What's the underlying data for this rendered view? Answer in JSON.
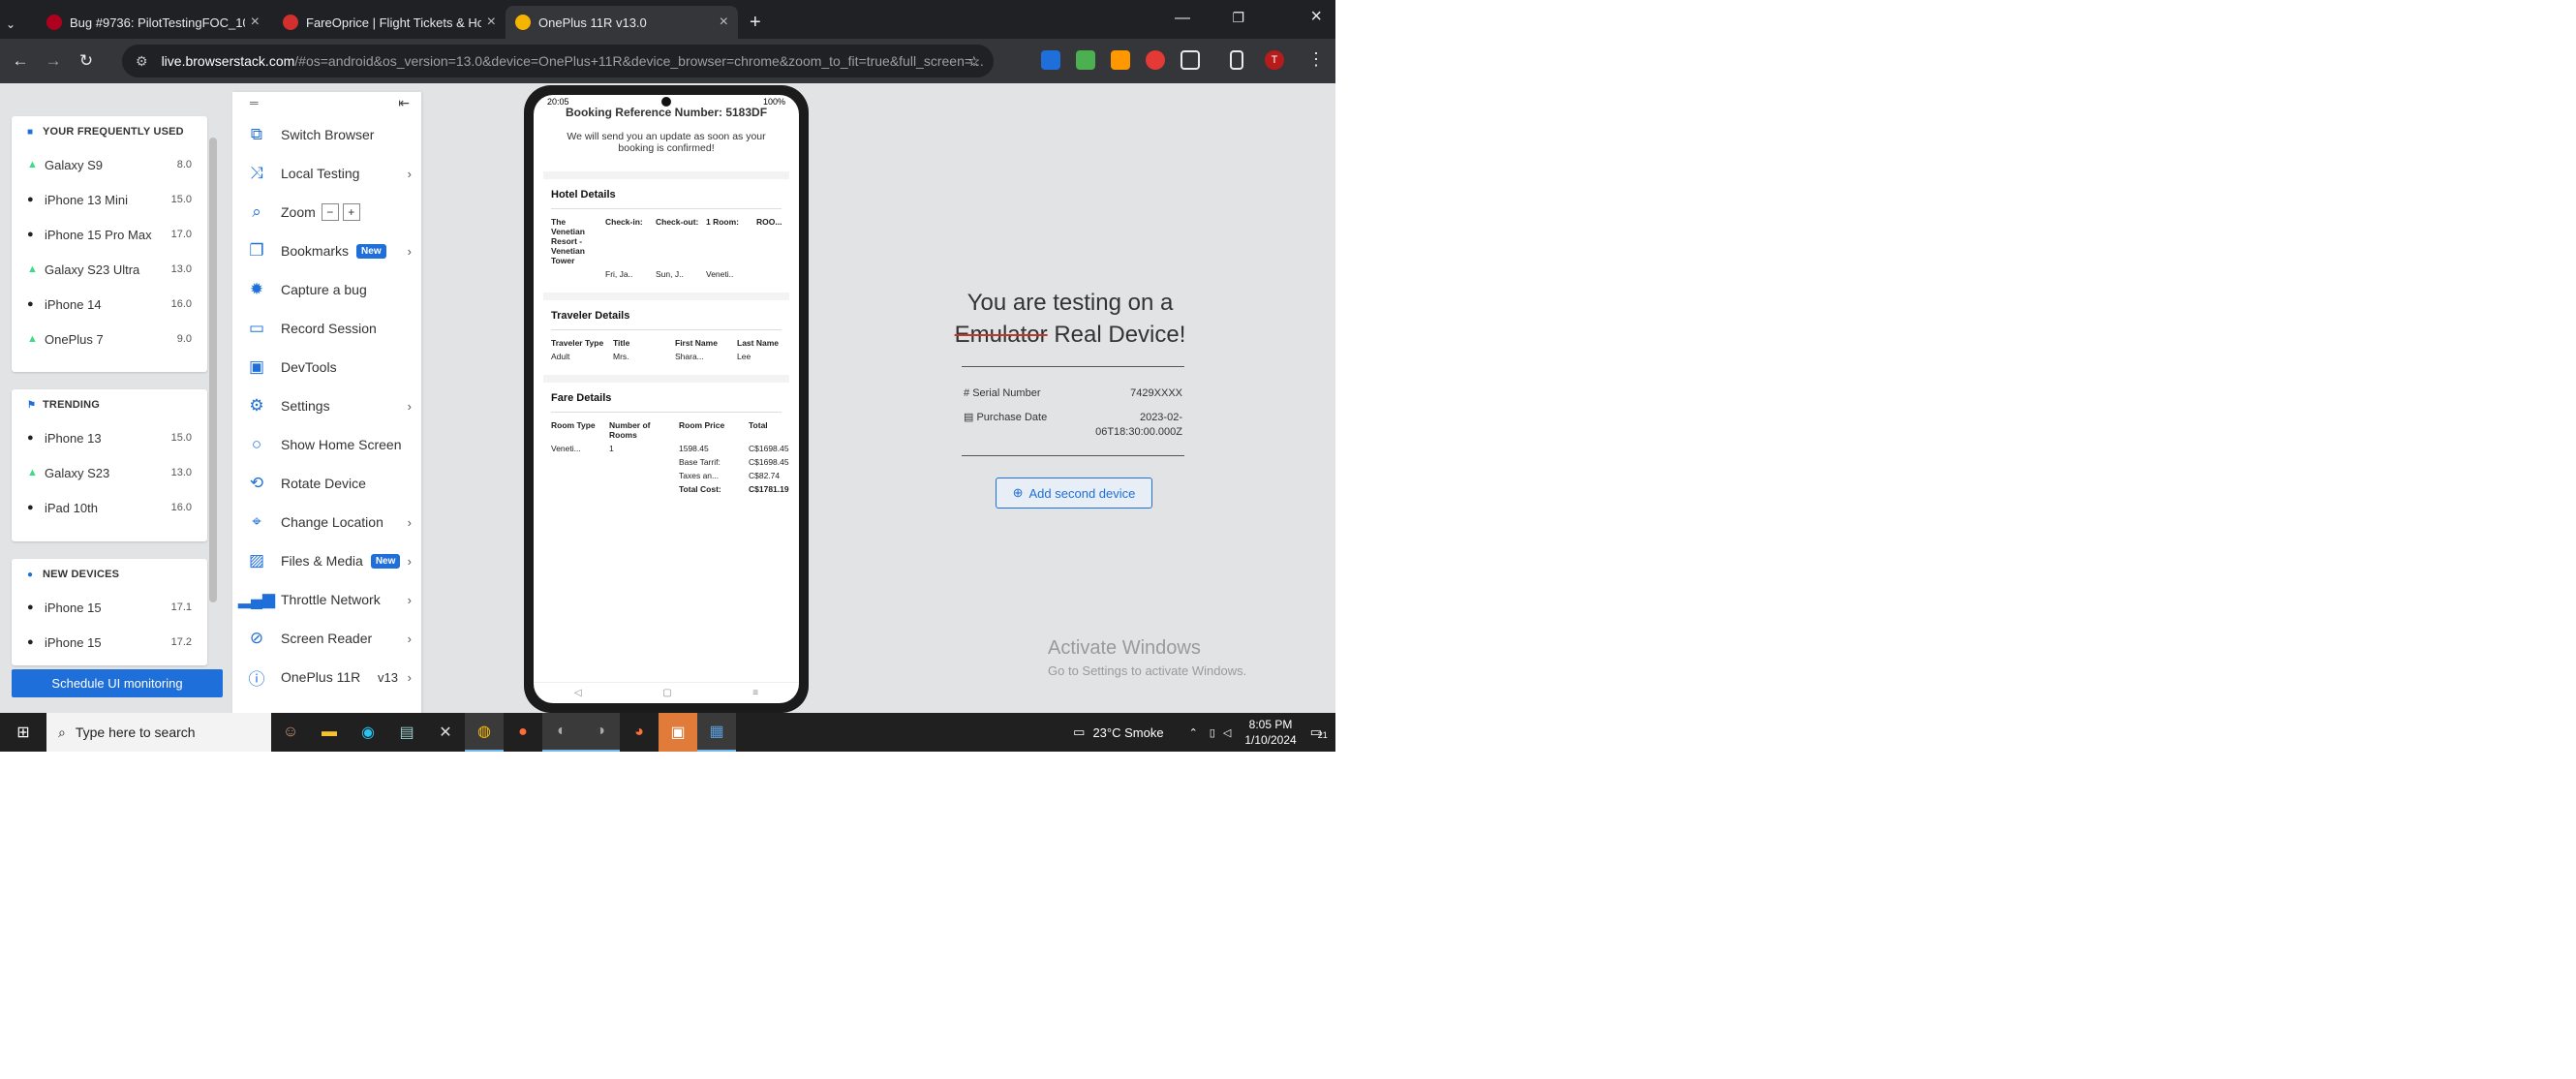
{
  "browser": {
    "tabs": [
      {
        "title": "Bug #9736: PilotTestingFOC_10",
        "color": "#b00020"
      },
      {
        "title": "FareOprice | Flight Tickets & Ho",
        "color": "#d32f2f"
      },
      {
        "title": "OnePlus 11R v13.0",
        "color": "#f4b400"
      }
    ],
    "url_host": "live.browserstack.com",
    "url_path": "/#os=android&os_version=13.0&device=OnePlus+11R&device_browser=chrome&zoom_to_fit=true&full_screen=...",
    "profile_initial": "T"
  },
  "left_panel": {
    "frequent_title": "YOUR FREQUENTLY USED",
    "frequent": [
      {
        "name": "Galaxy S9",
        "ver": "8.0",
        "os": "android"
      },
      {
        "name": "iPhone 13 Mini",
        "ver": "15.0",
        "os": "ios"
      },
      {
        "name": "iPhone 15 Pro Max",
        "ver": "17.0",
        "os": "ios"
      },
      {
        "name": "Galaxy S23 Ultra",
        "ver": "13.0",
        "os": "android"
      },
      {
        "name": "iPhone 14",
        "ver": "16.0",
        "os": "ios"
      },
      {
        "name": "OnePlus 7",
        "ver": "9.0",
        "os": "android"
      }
    ],
    "trending_title": "TRENDING",
    "trending": [
      {
        "name": "iPhone 13",
        "ver": "15.0",
        "os": "ios"
      },
      {
        "name": "Galaxy S23",
        "ver": "13.0",
        "os": "android"
      },
      {
        "name": "iPad 10th",
        "ver": "16.0",
        "os": "ios"
      }
    ],
    "new_title": "NEW DEVICES",
    "new": [
      {
        "name": "iPhone 15",
        "ver": "17.1",
        "os": "ios"
      },
      {
        "name": "iPhone 15",
        "ver": "17.2",
        "os": "ios"
      }
    ],
    "schedule_label": "Schedule UI monitoring"
  },
  "menu": {
    "items": [
      {
        "label": "Switch Browser"
      },
      {
        "label": "Local Testing"
      },
      {
        "label": "Zoom"
      },
      {
        "label": "Bookmarks",
        "badge": "New"
      },
      {
        "label": "Capture a bug"
      },
      {
        "label": "Record Session"
      },
      {
        "label": "DevTools"
      },
      {
        "label": "Settings"
      },
      {
        "label": "Show Home Screen"
      },
      {
        "label": "Rotate Device"
      },
      {
        "label": "Change Location"
      },
      {
        "label": "Files & Media",
        "badge": "New"
      },
      {
        "label": "Throttle Network"
      },
      {
        "label": "Screen Reader"
      },
      {
        "label": "OnePlus 11R",
        "suffix": "v13"
      }
    ],
    "zoom_minus": "−",
    "zoom_plus": "+"
  },
  "phone": {
    "time": "20:05",
    "battery": "100%",
    "booking_ref": "Booking Reference Number: 5183DF",
    "confirm_msg": "We will send you an update as soon as your booking is confirmed!",
    "hotel_title": "Hotel Details",
    "hotel_headers": [
      "The Venetian Resort - Venetian Tower",
      "Check-in:",
      "Check-out:",
      "1 Room:",
      "ROO..."
    ],
    "hotel_values": [
      "",
      "Fri, Ja..",
      "Sun, J..",
      "Veneti..",
      ""
    ],
    "traveler_title": "Traveler Details",
    "traveler_headers": [
      "Traveler Type",
      "Title",
      "First Name",
      "Last Name"
    ],
    "traveler_values": [
      "Adult",
      "Mrs.",
      "Shara...",
      "Lee"
    ],
    "fare_title": "Fare Details",
    "fare_headers": [
      "Room Type",
      "Number of Rooms",
      "Room Price",
      "Total"
    ],
    "fare_row": [
      "Veneti...",
      "1",
      "1598.45",
      "C$1698.45"
    ],
    "fare_lines": [
      {
        "k": "Base Tarrif:",
        "v": "C$1698.45"
      },
      {
        "k": "Taxes an...",
        "v": "C$82.74"
      },
      {
        "k": "Total Cost:",
        "v": "C$1781.19"
      }
    ]
  },
  "info": {
    "line1": "You are testing on a",
    "emulator": "Emulator",
    "real": "Real Device!",
    "serial_label": "Serial Number",
    "serial_value": "7429XXXX",
    "purchase_label": "Purchase Date",
    "purchase_value": "2023-02-06T18:30:00.000Z",
    "add_button": "Add second device"
  },
  "activate": {
    "title": "Activate Windows",
    "sub": "Go to Settings to activate Windows."
  },
  "taskbar": {
    "search_placeholder": "Type here to search",
    "weather": "23°C  Smoke",
    "time": "8:05 PM",
    "date": "1/10/2024",
    "notif_count": "21"
  }
}
